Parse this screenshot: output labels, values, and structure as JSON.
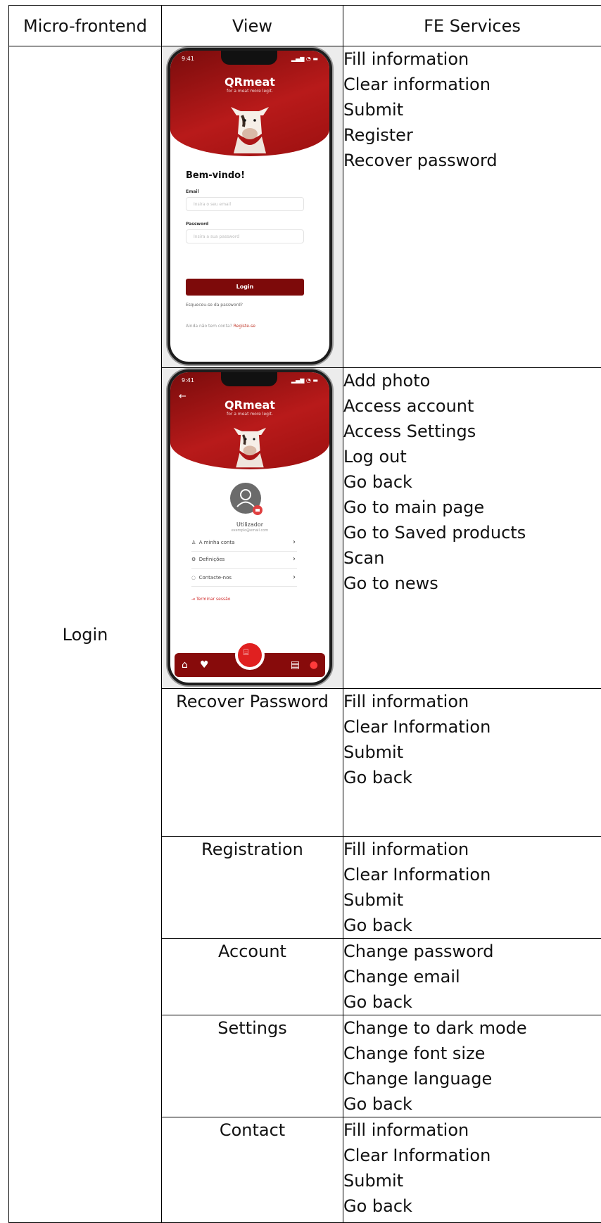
{
  "headers": [
    "Micro-frontend",
    "View",
    "FE Services"
  ],
  "micro_frontend": "Login",
  "rows": [
    {
      "view_kind": "screenshot-login",
      "services": [
        "Fill information",
        "Clear information",
        "Submit",
        "Register",
        "Recover password"
      ]
    },
    {
      "view_kind": "screenshot-profile",
      "services": [
        "Add photo",
        "Access account",
        "Access Settings",
        "Log out",
        "Go back",
        "Go to main page",
        "Go to Saved products",
        "Scan",
        "Go to news"
      ]
    },
    {
      "view": "Recover Password",
      "services": [
        "Fill information",
        "Clear Information",
        "Submit",
        "Go back"
      ]
    },
    {
      "view": "Registration",
      "services": [
        "Fill information",
        "Clear Information",
        "Submit",
        "Go back"
      ]
    },
    {
      "view": "Account",
      "services": [
        "Change password",
        "Change email",
        "Go back"
      ]
    },
    {
      "view": "Settings",
      "services": [
        "Change to dark mode",
        "Change font size",
        "Change language",
        "Go back"
      ]
    },
    {
      "view": "Contact",
      "services": [
        "Fill information",
        "Clear Information",
        "Submit",
        "Go back"
      ]
    }
  ],
  "login_phone": {
    "time": "9:41",
    "logo": "QRmeat",
    "tagline": "for a meat more legit.",
    "welcome": "Bem-vindo!",
    "email_label": "Email",
    "email_placeholder": "Insira o seu email",
    "password_label": "Password",
    "password_placeholder": "Insira a sua password",
    "login_button": "Login",
    "forgot": "Esqueceu-se da password?",
    "no_account": "Ainda não tem conta?",
    "register": "Registe-se"
  },
  "profile_phone": {
    "time": "9:41",
    "logo": "QRmeat",
    "tagline": "for a meat more legit.",
    "user_name": "Utilizador",
    "user_email": "exemplo@email.com",
    "menu": [
      "A minha conta",
      "Definições",
      "Contacte-nos"
    ],
    "logout": "Terminar sessão"
  },
  "colors": {
    "brand_red": "#8b0d0d",
    "accent_red": "#e02020"
  }
}
